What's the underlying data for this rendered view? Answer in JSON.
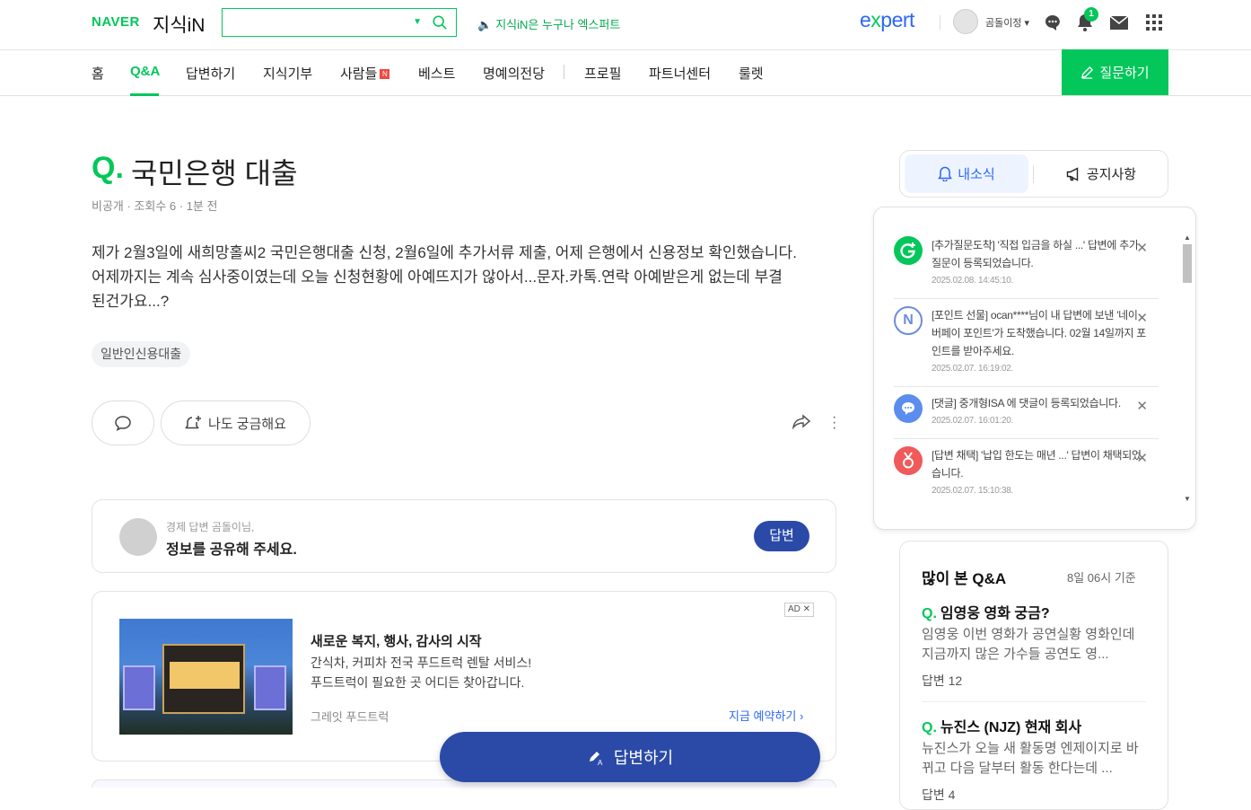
{
  "header": {
    "naver_logo": "NAVER",
    "kin_logo": "지식iN",
    "search": {
      "value": "",
      "placeholder": ""
    },
    "promo": "지식iN은 누구나 엑스퍼트",
    "expert_logo_main": "e",
    "expert_logo_accent": "x",
    "expert_logo_rest": "pert",
    "user_name": "곰돌이정",
    "notification_count": "1"
  },
  "nav": {
    "items": [
      {
        "label": "홈"
      },
      {
        "label": "Q&A"
      },
      {
        "label": "답변하기"
      },
      {
        "label": "지식기부"
      },
      {
        "label": "사람들"
      },
      {
        "label": "베스트"
      },
      {
        "label": "명예의전당"
      },
      {
        "label": "프로필"
      },
      {
        "label": "파트너센터"
      },
      {
        "label": "룰렛"
      }
    ],
    "new_badge": "N",
    "ask_button": "질문하기"
  },
  "question": {
    "q_mark": "Q.",
    "title": "국민은행 대출",
    "meta": "비공개 · 조회수 6 · 1분 전",
    "body": "제가 2월3일에 새희망홀씨2 국민은행대출 신청, 2월6일에 추가서류 제출, 어제 은행에서 신용정보 확인했습니다.\n어제까지는 계속 심사중이였는데 오늘 신청현황에 아예뜨지가 않아서...문자.카톡.연락 아예받은게 없는데 부결\n된건가요...?",
    "tag": "일반인신용대출",
    "curious_button": "나도 궁금해요"
  },
  "answer_prompt": {
    "label": "경제 답변 곰돌이님,",
    "prompt": "정보를 공유해 주세요.",
    "button": "답변"
  },
  "ad": {
    "badge": "AD",
    "title": "새로운 복지, 행사, 감사의 시작",
    "desc": "간식차, 커피차 전국 푸드트럭 렌탈 서비스!\n푸드트럭이 필요한 곳 어디든 찾아갑니다.",
    "source": "그레잇 푸드트럭",
    "cta": "지금 예약하기 ›"
  },
  "floating_button": "답변하기",
  "side_tabs": {
    "news": "내소식",
    "notice": "공지사항"
  },
  "notifications": [
    {
      "text": "[추가질문도착] '직접 입금을 하실 ...' 답변에 추가질문이 등록되었습니다.",
      "time": "2025.02.08. 14:45:10.",
      "icon_color": "#03c75a",
      "icon": "G+"
    },
    {
      "text": "[포인트 선물] ocan****님이 내 답변에 보낸 '네이버페이 포인트'가 도착했습니다. 02월 14일까지 포인트를 받아주세요.",
      "time": "2025.02.07. 16:19:02.",
      "icon_color": "#6b8de0",
      "icon": "N"
    },
    {
      "text": "[댓글] 중개형ISA 에 댓글이 등록되었습니다.",
      "time": "2025.02.07. 16:01:20.",
      "icon_color": "#5b8def",
      "icon": "…"
    },
    {
      "text": "[답변 채택] '납입 한도는 매년 ...' 답변이 채택되었습니다.",
      "time": "2025.02.07. 15:10:38.",
      "icon_color": "#f05a5a",
      "icon": "ö"
    }
  ],
  "top_qa": {
    "title": "많이 본 Q&A",
    "time": "8일 06시 기준",
    "items": [
      {
        "q": "임영웅 영화 궁금?",
        "snippet": "임영웅 이번 영화가 공연실황 영화인데 지금까지 많은 가수들 공연도 영...",
        "count": "답변 12"
      },
      {
        "q": "뉴진스 (NJZ) 현재 회사",
        "snippet": "뉴진스가 오늘 새 활동명 엔제이지로 바뀌고 다음 달부터 활동 한다는데 ...",
        "count": "답변 4"
      }
    ]
  }
}
